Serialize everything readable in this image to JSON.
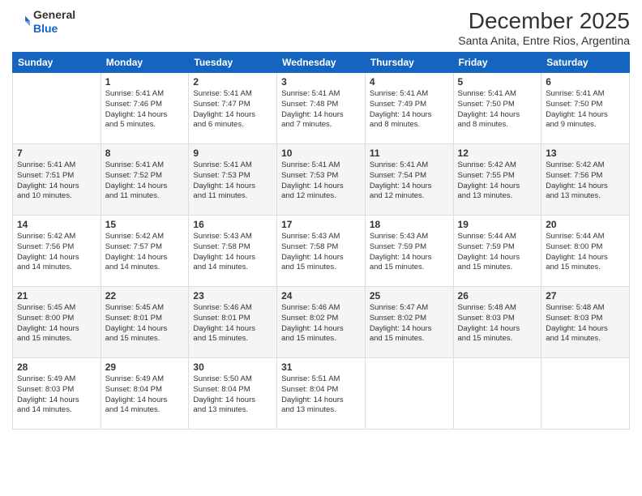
{
  "logo": {
    "general": "General",
    "blue": "Blue"
  },
  "header": {
    "month": "December 2025",
    "location": "Santa Anita, Entre Rios, Argentina"
  },
  "days_of_week": [
    "Sunday",
    "Monday",
    "Tuesday",
    "Wednesday",
    "Thursday",
    "Friday",
    "Saturday"
  ],
  "weeks": [
    [
      {
        "day": "",
        "info": ""
      },
      {
        "day": "1",
        "info": "Sunrise: 5:41 AM\nSunset: 7:46 PM\nDaylight: 14 hours\nand 5 minutes."
      },
      {
        "day": "2",
        "info": "Sunrise: 5:41 AM\nSunset: 7:47 PM\nDaylight: 14 hours\nand 6 minutes."
      },
      {
        "day": "3",
        "info": "Sunrise: 5:41 AM\nSunset: 7:48 PM\nDaylight: 14 hours\nand 7 minutes."
      },
      {
        "day": "4",
        "info": "Sunrise: 5:41 AM\nSunset: 7:49 PM\nDaylight: 14 hours\nand 8 minutes."
      },
      {
        "day": "5",
        "info": "Sunrise: 5:41 AM\nSunset: 7:50 PM\nDaylight: 14 hours\nand 8 minutes."
      },
      {
        "day": "6",
        "info": "Sunrise: 5:41 AM\nSunset: 7:50 PM\nDaylight: 14 hours\nand 9 minutes."
      }
    ],
    [
      {
        "day": "7",
        "info": "Sunrise: 5:41 AM\nSunset: 7:51 PM\nDaylight: 14 hours\nand 10 minutes."
      },
      {
        "day": "8",
        "info": "Sunrise: 5:41 AM\nSunset: 7:52 PM\nDaylight: 14 hours\nand 11 minutes."
      },
      {
        "day": "9",
        "info": "Sunrise: 5:41 AM\nSunset: 7:53 PM\nDaylight: 14 hours\nand 11 minutes."
      },
      {
        "day": "10",
        "info": "Sunrise: 5:41 AM\nSunset: 7:53 PM\nDaylight: 14 hours\nand 12 minutes."
      },
      {
        "day": "11",
        "info": "Sunrise: 5:41 AM\nSunset: 7:54 PM\nDaylight: 14 hours\nand 12 minutes."
      },
      {
        "day": "12",
        "info": "Sunrise: 5:42 AM\nSunset: 7:55 PM\nDaylight: 14 hours\nand 13 minutes."
      },
      {
        "day": "13",
        "info": "Sunrise: 5:42 AM\nSunset: 7:56 PM\nDaylight: 14 hours\nand 13 minutes."
      }
    ],
    [
      {
        "day": "14",
        "info": "Sunrise: 5:42 AM\nSunset: 7:56 PM\nDaylight: 14 hours\nand 14 minutes."
      },
      {
        "day": "15",
        "info": "Sunrise: 5:42 AM\nSunset: 7:57 PM\nDaylight: 14 hours\nand 14 minutes."
      },
      {
        "day": "16",
        "info": "Sunrise: 5:43 AM\nSunset: 7:58 PM\nDaylight: 14 hours\nand 14 minutes."
      },
      {
        "day": "17",
        "info": "Sunrise: 5:43 AM\nSunset: 7:58 PM\nDaylight: 14 hours\nand 15 minutes."
      },
      {
        "day": "18",
        "info": "Sunrise: 5:43 AM\nSunset: 7:59 PM\nDaylight: 14 hours\nand 15 minutes."
      },
      {
        "day": "19",
        "info": "Sunrise: 5:44 AM\nSunset: 7:59 PM\nDaylight: 14 hours\nand 15 minutes."
      },
      {
        "day": "20",
        "info": "Sunrise: 5:44 AM\nSunset: 8:00 PM\nDaylight: 14 hours\nand 15 minutes."
      }
    ],
    [
      {
        "day": "21",
        "info": "Sunrise: 5:45 AM\nSunset: 8:00 PM\nDaylight: 14 hours\nand 15 minutes."
      },
      {
        "day": "22",
        "info": "Sunrise: 5:45 AM\nSunset: 8:01 PM\nDaylight: 14 hours\nand 15 minutes."
      },
      {
        "day": "23",
        "info": "Sunrise: 5:46 AM\nSunset: 8:01 PM\nDaylight: 14 hours\nand 15 minutes."
      },
      {
        "day": "24",
        "info": "Sunrise: 5:46 AM\nSunset: 8:02 PM\nDaylight: 14 hours\nand 15 minutes."
      },
      {
        "day": "25",
        "info": "Sunrise: 5:47 AM\nSunset: 8:02 PM\nDaylight: 14 hours\nand 15 minutes."
      },
      {
        "day": "26",
        "info": "Sunrise: 5:48 AM\nSunset: 8:03 PM\nDaylight: 14 hours\nand 15 minutes."
      },
      {
        "day": "27",
        "info": "Sunrise: 5:48 AM\nSunset: 8:03 PM\nDaylight: 14 hours\nand 14 minutes."
      }
    ],
    [
      {
        "day": "28",
        "info": "Sunrise: 5:49 AM\nSunset: 8:03 PM\nDaylight: 14 hours\nand 14 minutes."
      },
      {
        "day": "29",
        "info": "Sunrise: 5:49 AM\nSunset: 8:04 PM\nDaylight: 14 hours\nand 14 minutes."
      },
      {
        "day": "30",
        "info": "Sunrise: 5:50 AM\nSunset: 8:04 PM\nDaylight: 14 hours\nand 13 minutes."
      },
      {
        "day": "31",
        "info": "Sunrise: 5:51 AM\nSunset: 8:04 PM\nDaylight: 14 hours\nand 13 minutes."
      },
      {
        "day": "",
        "info": ""
      },
      {
        "day": "",
        "info": ""
      },
      {
        "day": "",
        "info": ""
      }
    ]
  ]
}
